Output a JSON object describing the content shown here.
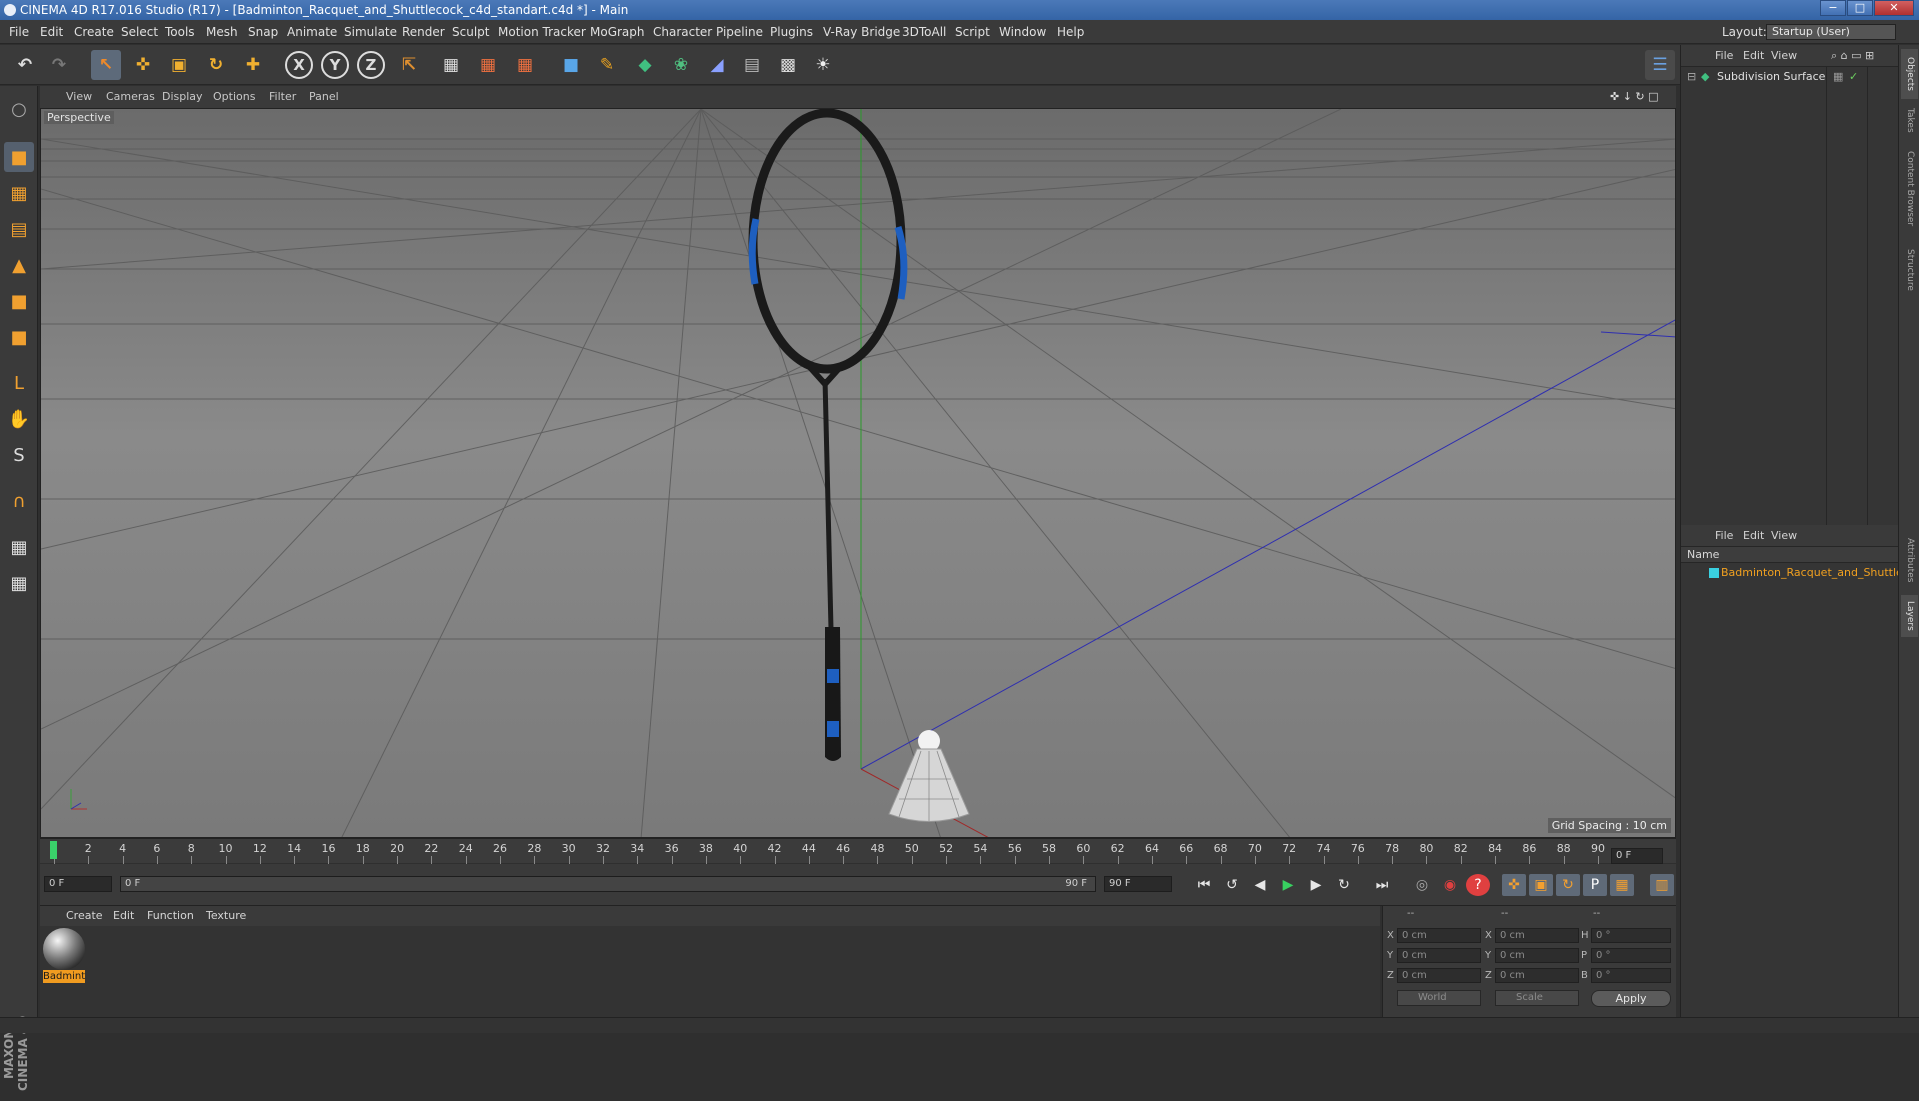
{
  "window": {
    "title": "CINEMA 4D R17.016 Studio (R17) - [Badminton_Racquet_and_Shuttlecock_c4d_standart.c4d *] - Main",
    "min": "−",
    "max": "□",
    "close": "✕"
  },
  "menubar": {
    "items": [
      "File",
      "Edit",
      "Create",
      "Select",
      "Tools",
      "Mesh",
      "Snap",
      "Animate",
      "Simulate",
      "Render",
      "Sculpt",
      "Motion Tracker",
      "MoGraph",
      "Character",
      "Pipeline",
      "Plugins",
      "V-Ray Bridge",
      "3DToAll",
      "Script",
      "Window",
      "Help"
    ],
    "layout_label": "Layout:",
    "layout_value": "Startup (User)"
  },
  "toolbar": {
    "undo": "↶",
    "redo": "↷",
    "select": "↖",
    "move": "✜",
    "scale": "▣",
    "rotate": "↻",
    "multi": "✚",
    "x": "X",
    "y": "Y",
    "z": "Z",
    "coord": "⇱",
    "render_view": "▦",
    "render_picture": "▦",
    "render_settings": "▦",
    "cube": "■",
    "pen": "✎",
    "subdiv": "◆",
    "cloner": "❀",
    "deform": "◢",
    "floor": "▤",
    "camera": "▩",
    "light": "☀",
    "python": "☰"
  },
  "icons": {
    "move": "move-icon",
    "scale": "scale-icon",
    "rotate": "rotate-icon"
  },
  "lefttools": {
    "items": [
      "○",
      "■",
      "▦",
      "▤",
      "▲",
      "■",
      "■",
      "L",
      "✋",
      "S",
      "∩",
      "▦",
      "▦"
    ]
  },
  "viewport": {
    "menu": [
      "View",
      "Cameras",
      "Display",
      "Options",
      "Filter",
      "Panel"
    ],
    "label": "Perspective",
    "grid_spacing": "Grid Spacing : 10 cm",
    "nav_icons": "✜ ↓ ↻ □"
  },
  "timeline": {
    "ticks": [
      "0",
      "2",
      "4",
      "6",
      "8",
      "10",
      "12",
      "14",
      "16",
      "18",
      "20",
      "22",
      "24",
      "26",
      "28",
      "30",
      "32",
      "34",
      "36",
      "38",
      "40",
      "42",
      "44",
      "46",
      "48",
      "50",
      "52",
      "54",
      "56",
      "58",
      "60",
      "62",
      "64",
      "66",
      "68",
      "70",
      "72",
      "74",
      "76",
      "78",
      "80",
      "82",
      "84",
      "86",
      "88",
      "90"
    ],
    "current_frame": "0 F",
    "start": "0 F",
    "range_start": "0 F",
    "range_end": "90 F",
    "end": "90 F"
  },
  "transport": {
    "first": "⏮",
    "prev_key": "↺",
    "prev": "◀",
    "play": "▶",
    "next": "▶",
    "loop": "↻",
    "last": "⏭",
    "rec1": "◎",
    "rec2": "◉",
    "help": "?",
    "k1": "✜",
    "k2": "▣",
    "k3": "↻",
    "k4": "P",
    "k5": "▦",
    "film": "▥"
  },
  "materials": {
    "menu": [
      "Create",
      "Edit",
      "Function",
      "Texture"
    ],
    "items": [
      {
        "name": "Badmint"
      }
    ]
  },
  "coords": {
    "headers": [
      "--",
      "--",
      "--"
    ],
    "rows": [
      {
        "a": "X",
        "av": "0 cm",
        "b": "X",
        "bv": "0 cm",
        "c": "H",
        "cv": "0 °"
      },
      {
        "a": "Y",
        "av": "0 cm",
        "b": "Y",
        "bv": "0 cm",
        "c": "P",
        "cv": "0 °"
      },
      {
        "a": "Z",
        "av": "0 cm",
        "b": "Z",
        "bv": "0 cm",
        "c": "B",
        "cv": "0 °"
      }
    ],
    "mode1": "World",
    "mode2": "Scale",
    "apply": "Apply"
  },
  "objects": {
    "menu": [
      "File",
      "Edit",
      "View"
    ],
    "items": [
      {
        "name": "Subdivision Surface"
      }
    ]
  },
  "layers": {
    "menu": [
      "File",
      "Edit",
      "View"
    ],
    "header": "Name",
    "items": [
      {
        "name": "Badminton_Racquet_and_Shuttlecock"
      }
    ]
  },
  "side_tabs": [
    "Objects",
    "Takes",
    "Content Browser",
    "Structure",
    "Attributes",
    "Layers"
  ],
  "maxon": "MAXON CINEMA 4D",
  "colors": {
    "accent": "#f0a030",
    "selected_tool": "#5d6a7a",
    "layer_text": "#f0a020",
    "racket_blue": "#1e5fc0"
  }
}
